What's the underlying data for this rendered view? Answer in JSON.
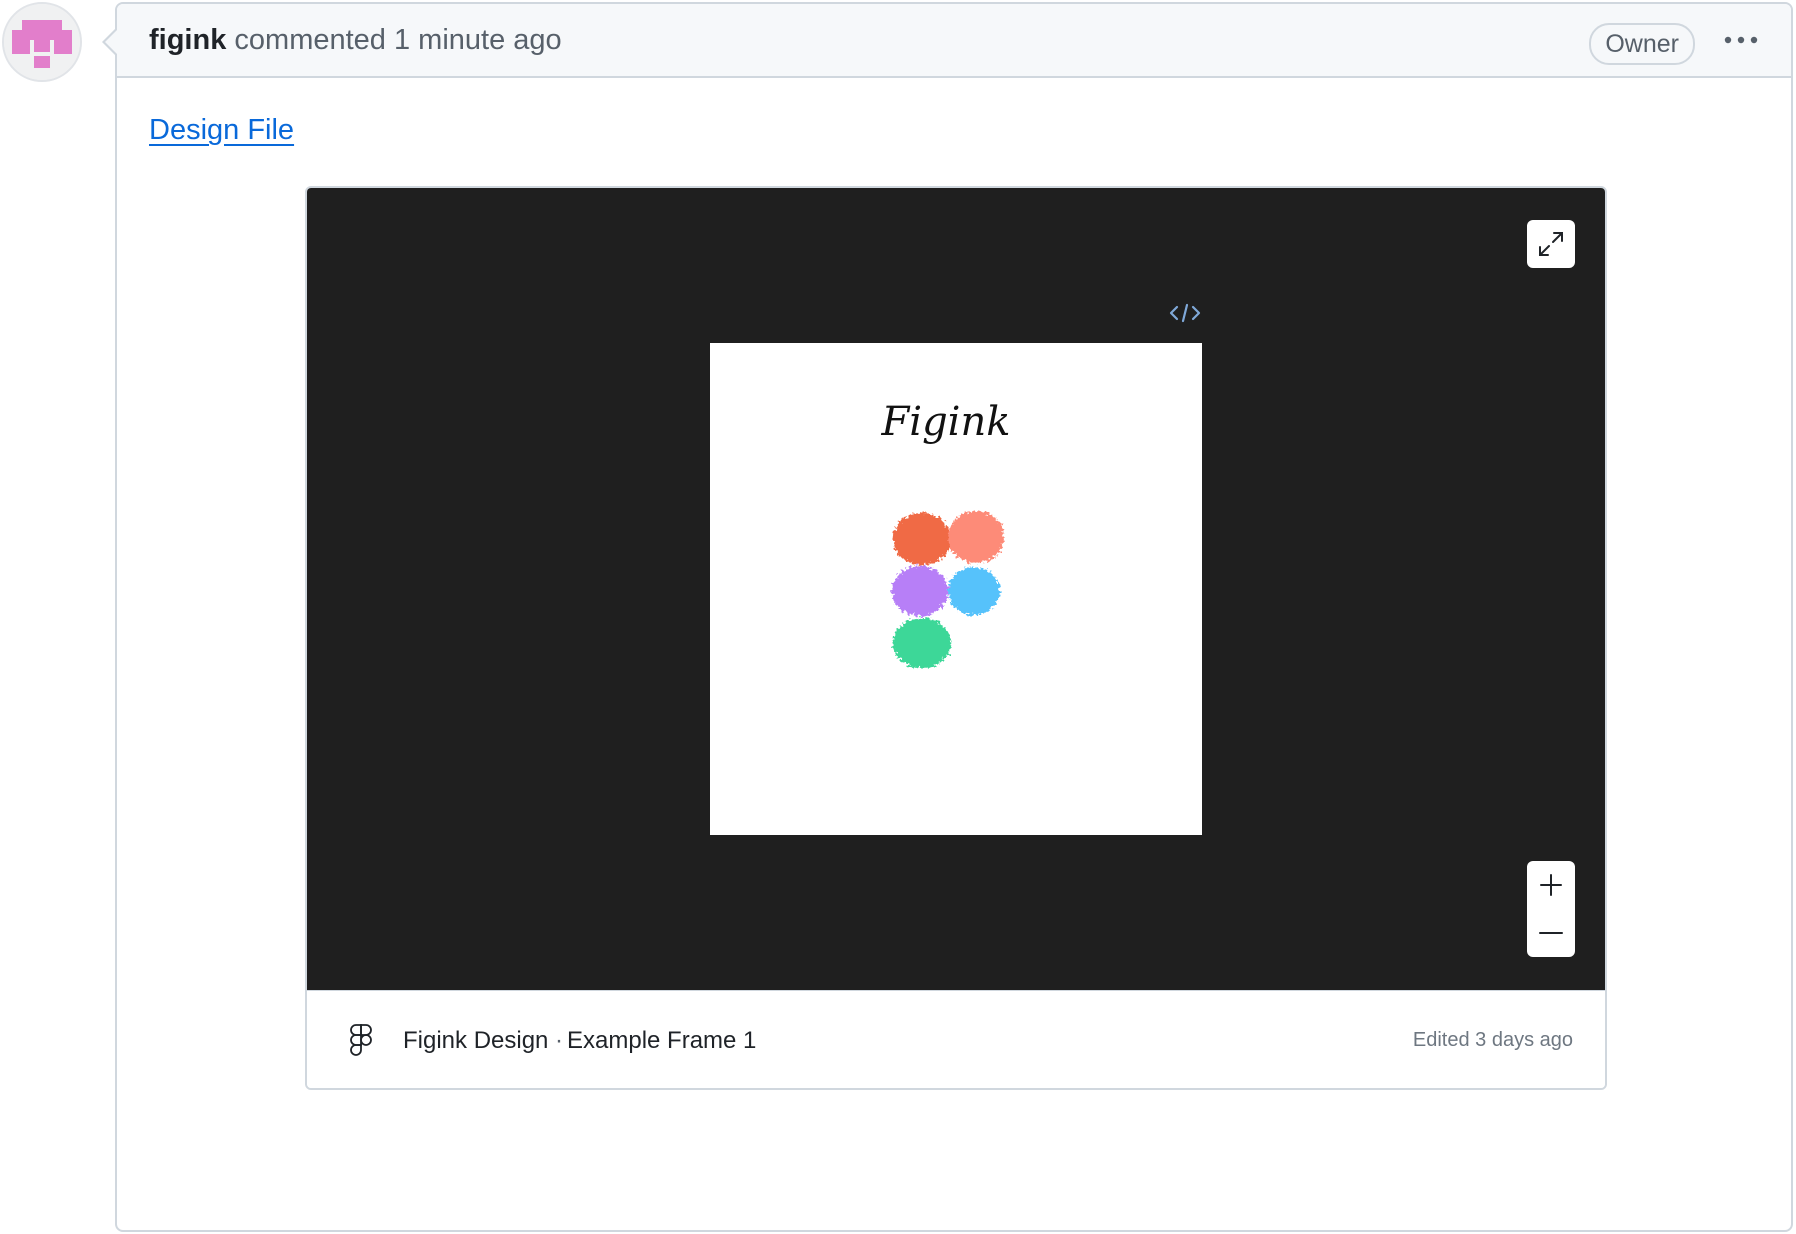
{
  "comment": {
    "author": "figink",
    "action": "commented",
    "time": "1 minute ago",
    "badge": "Owner",
    "more_label": "•••",
    "link_text": "Design File"
  },
  "embed": {
    "frame_title": "Figink",
    "file_name": "Figink Design",
    "separator": "·",
    "frame_name": "Example Frame 1",
    "edited": "Edited 3 days ago"
  },
  "colors": {
    "avatar_pink": "#e27ecb",
    "canvas_bg": "#1f1f1f",
    "link": "#0969da",
    "blob_orange": "#f06b45",
    "blob_salmon": "#fd8b78",
    "blob_purple": "#b77ff7",
    "blob_blue": "#56c2fb",
    "blob_green": "#3dd798"
  },
  "icons": {
    "avatar": "identicon",
    "more": "kebab-horizontal-icon",
    "code": "code-icon",
    "expand": "expand-arrows-icon",
    "zoom_in": "plus-icon",
    "zoom_out": "minus-icon",
    "figma": "figma-logo-icon"
  }
}
